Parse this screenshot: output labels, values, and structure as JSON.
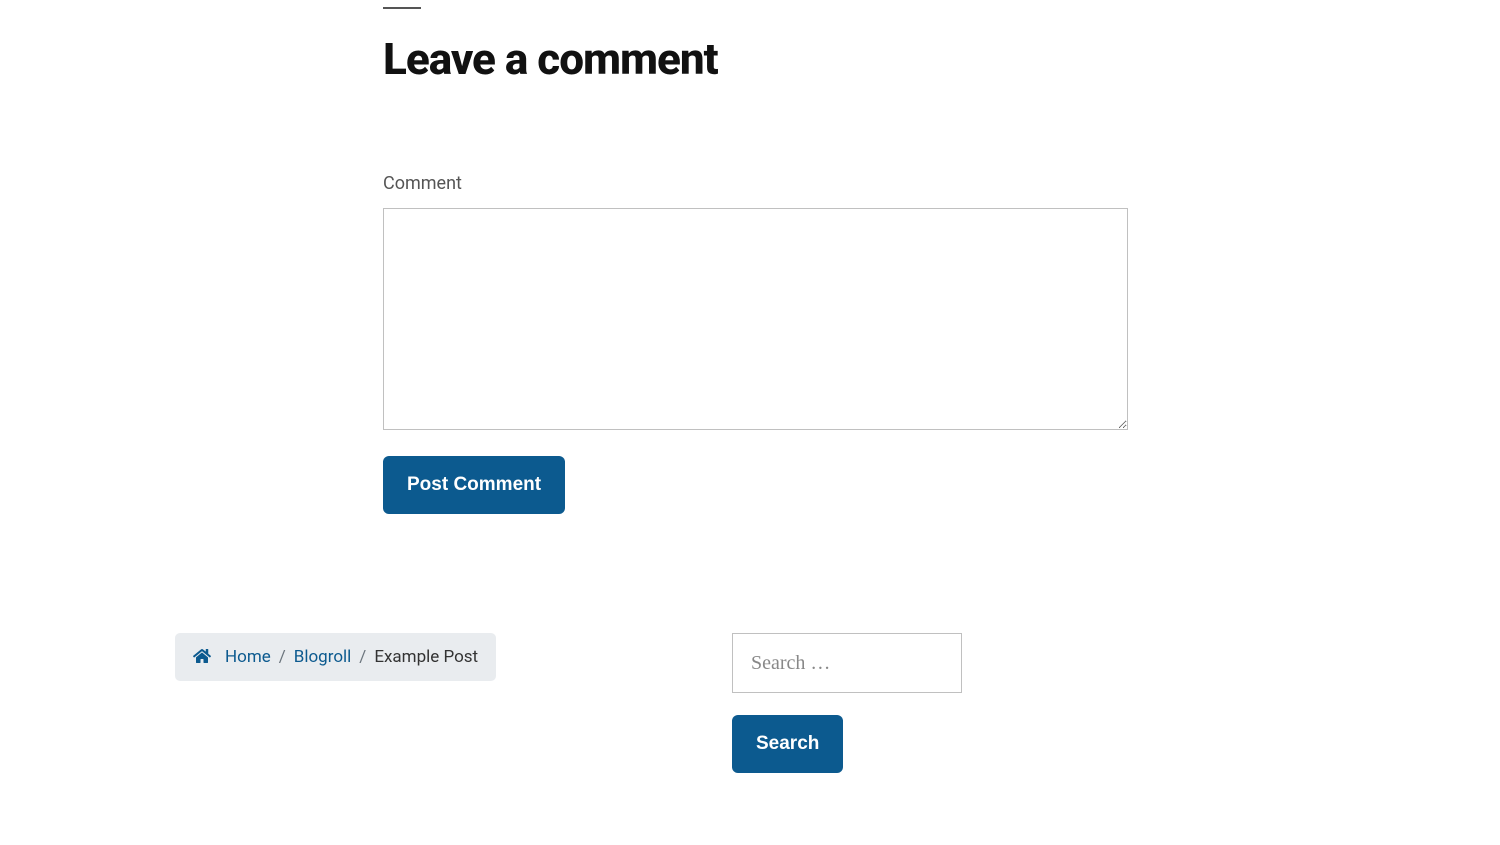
{
  "comment_section": {
    "heading": "Leave a comment",
    "field_label": "Comment",
    "submit_label": "Post Comment"
  },
  "breadcrumb": {
    "home_label": "Home",
    "items": [
      {
        "label": "Blogroll"
      }
    ],
    "current": "Example Post"
  },
  "search": {
    "placeholder": "Search …",
    "button_label": "Search"
  }
}
